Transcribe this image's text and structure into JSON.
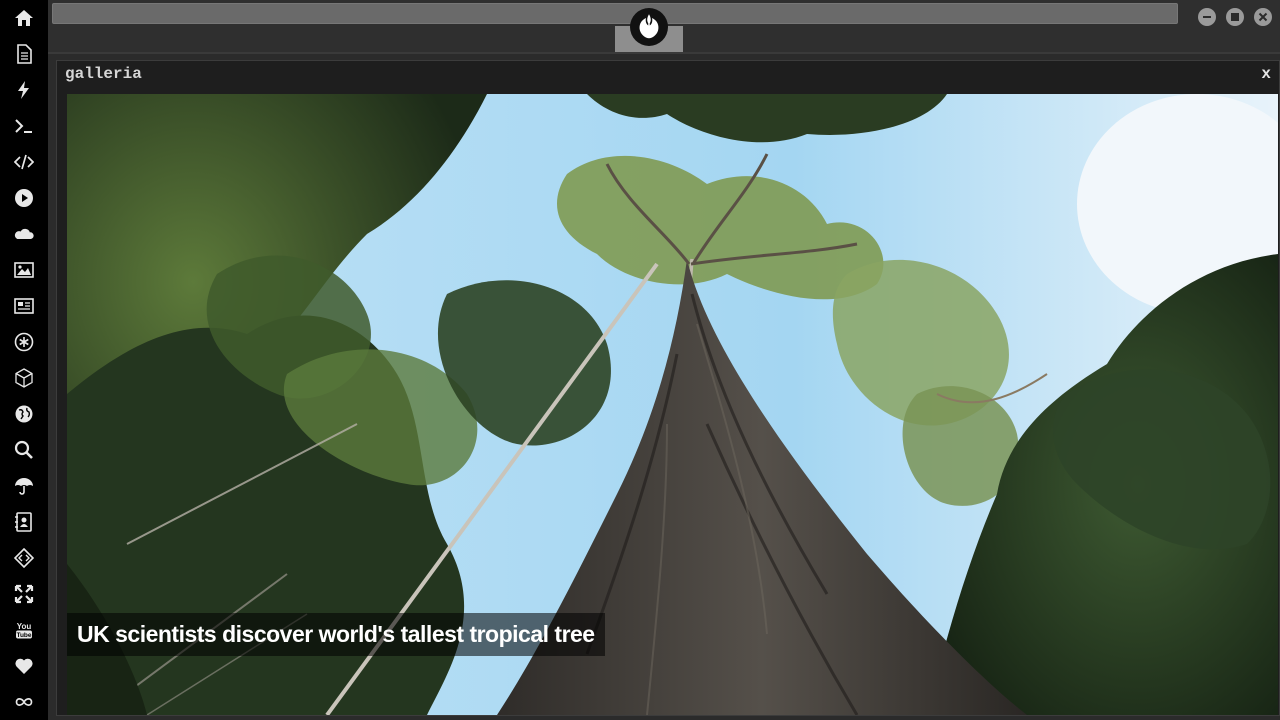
{
  "sidebar": {
    "items": [
      {
        "name": "home-icon"
      },
      {
        "name": "document-icon"
      },
      {
        "name": "lightning-icon"
      },
      {
        "name": "terminal-icon"
      },
      {
        "name": "code-icon"
      },
      {
        "name": "play-icon"
      },
      {
        "name": "cloud-icon"
      },
      {
        "name": "image-icon"
      },
      {
        "name": "newspaper-icon"
      },
      {
        "name": "asterisk-icon"
      },
      {
        "name": "cube-icon"
      },
      {
        "name": "globe-icon"
      },
      {
        "name": "search-icon"
      },
      {
        "name": "umbrella-icon"
      },
      {
        "name": "contact-book-icon"
      },
      {
        "name": "diamond-code-icon"
      },
      {
        "name": "expand-icon"
      },
      {
        "name": "youtube-icon"
      },
      {
        "name": "heart-icon"
      },
      {
        "name": "infinity-icon"
      }
    ]
  },
  "topbar": {
    "logo": "rebel-alliance-icon",
    "buttons": [
      "minimize-icon",
      "maximize-icon",
      "close-icon"
    ]
  },
  "gallery": {
    "title": "galleria",
    "close_label": "x",
    "caption": "UK scientists discover world's tallest tropical tree"
  },
  "colors": {
    "sidebar_bg": "#000000",
    "window_bg": "#1e1e1e",
    "topbar_bg": "#2f2f2f"
  }
}
